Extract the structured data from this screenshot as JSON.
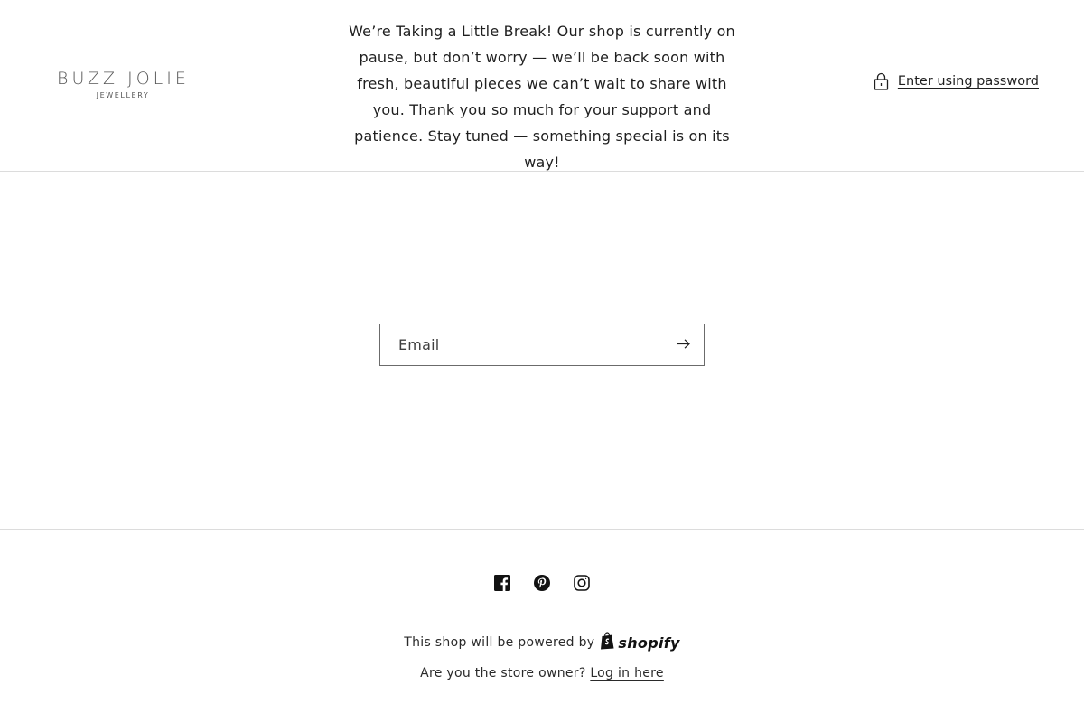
{
  "header": {
    "logo": {
      "name": "BUZZ JOLIE",
      "subtitle": "JEWELLERY"
    },
    "announcement": "We’re Taking a Little Break! Our shop is currently on pause, but don’t worry — we’ll be back soon with fresh, beautiful pieces we can’t wait to share with you. Thank you so much for your support and patience. Stay tuned — something special is on its way!",
    "password_link": {
      "label": "Enter using password",
      "icon": "lock-icon"
    }
  },
  "newsletter": {
    "email_placeholder": "Email",
    "email_value": "",
    "submit_icon": "arrow-right-icon"
  },
  "footer": {
    "socials": [
      {
        "name": "Facebook",
        "icon": "facebook-icon"
      },
      {
        "name": "Pinterest",
        "icon": "pinterest-icon"
      },
      {
        "name": "Instagram",
        "icon": "instagram-icon"
      }
    ],
    "powered_by_text": "This shop will be powered by",
    "powered_by_brand": "shopify",
    "owner_prompt": "Are you the store owner?",
    "login_link": "Log in here"
  },
  "colors": {
    "text": "#121212",
    "border": "#dcdcdc",
    "input_border": "#6b6b6b",
    "background": "#ffffff"
  }
}
